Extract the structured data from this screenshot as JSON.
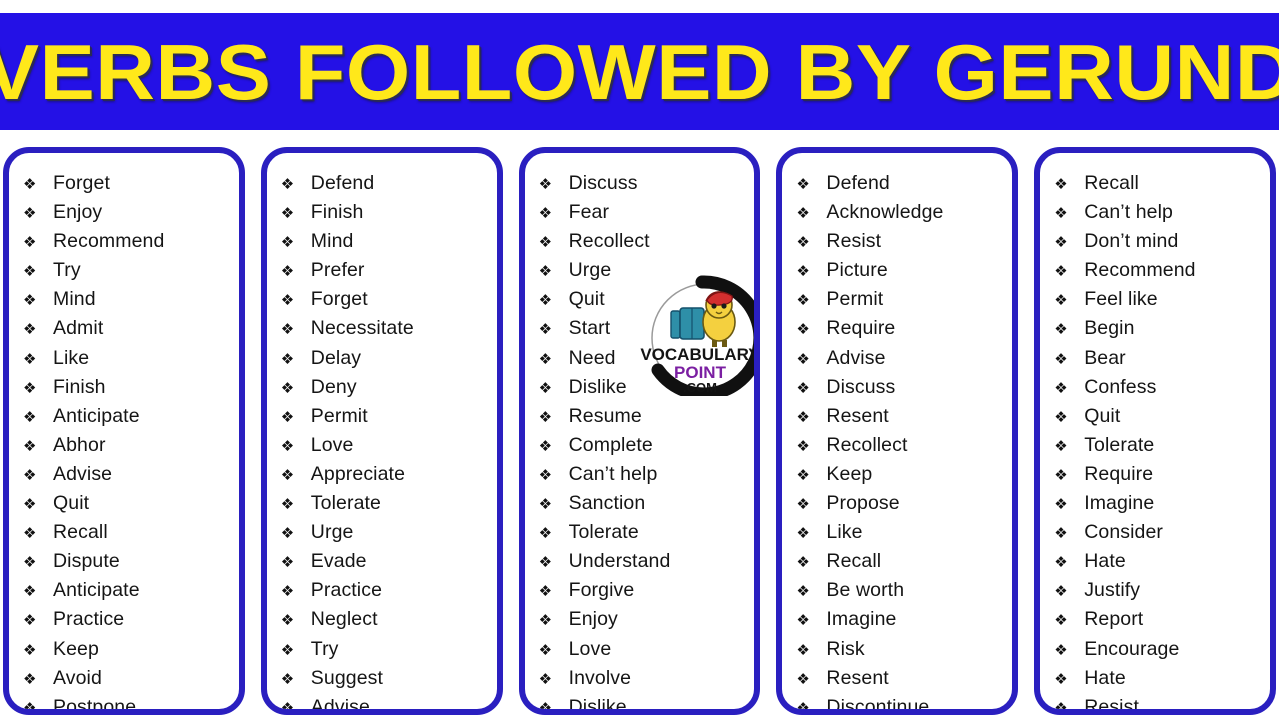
{
  "header": {
    "title": "VERBS FOLLOWED BY GERUND",
    "background_color": "#2411E6",
    "text_color": "#FFE81A"
  },
  "theme": {
    "card_border_color": "#2A1FC0",
    "card_background": "#FFFFFF",
    "text_color": "#151515",
    "bullet_glyph": "❖"
  },
  "watermark": {
    "line1": "VOCABULARY",
    "line2": "POINT",
    "line3": ".COM",
    "line1_color": "#141414",
    "line2_color": "#7B1FA2",
    "line3_color": "#141414",
    "ring_color": "#101010",
    "character": "chick-with-beret",
    "book_color": "#2E8FA8",
    "beret_color": "#D32F2F",
    "body_color": "#F4D03F"
  },
  "columns": [
    {
      "id": "column-1",
      "items": [
        "Forget",
        "Enjoy",
        "Recommend",
        "Try",
        "Mind",
        "Admit",
        "Like",
        "Finish",
        "Anticipate",
        "Abhor",
        "Advise",
        "Quit",
        "Recall",
        "Dispute",
        "Anticipate",
        "Practice",
        "Keep",
        "Avoid",
        "Postpone"
      ]
    },
    {
      "id": "column-2",
      "items": [
        "Defend",
        "Finish",
        "Mind",
        "Prefer",
        "Forget",
        "Necessitate",
        "Delay",
        "Deny",
        "Permit",
        "Love",
        "Appreciate",
        "Tolerate",
        "Urge",
        "Evade",
        "Practice",
        "Neglect",
        "Try",
        "Suggest",
        "Advise"
      ]
    },
    {
      "id": "column-3",
      "items": [
        "Discuss",
        "Fear",
        "Recollect",
        "Urge",
        "Quit",
        "Start",
        "Need",
        "Dislike",
        "Resume",
        "Complete",
        "Can’t help",
        "Sanction",
        "Tolerate",
        "Understand",
        "Forgive",
        "Enjoy",
        "Love",
        "Involve",
        "Dislike"
      ]
    },
    {
      "id": "column-4",
      "items": [
        "Defend",
        "Acknowledge",
        "Resist",
        "Picture",
        "Permit",
        "Require",
        "Advise",
        "Discuss",
        "Resent",
        "Recollect",
        "Keep",
        "Propose",
        "Like",
        "Recall",
        "Be worth",
        "Imagine",
        "Risk",
        "Resent",
        "Discontinue"
      ]
    },
    {
      "id": "column-5",
      "items": [
        "Recall",
        "Can’t help",
        "Don’t mind",
        "Recommend",
        "Feel like",
        "Begin",
        "Bear",
        "Confess",
        "Quit",
        "Tolerate",
        "Require",
        "Imagine",
        "Consider",
        "Hate",
        "Justify",
        "Report",
        "Encourage",
        "Hate",
        "Resist"
      ]
    }
  ]
}
